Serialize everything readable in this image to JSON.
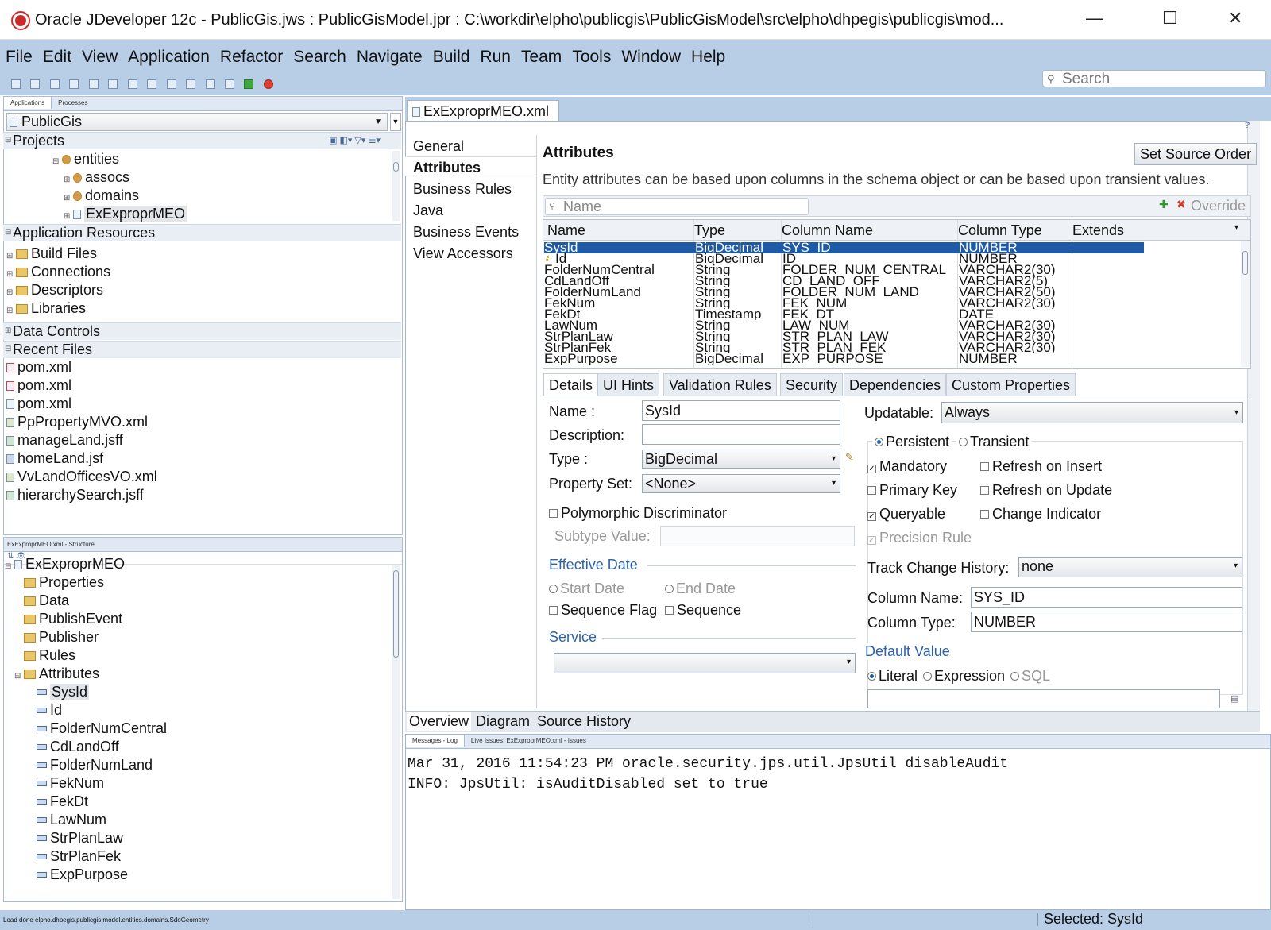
{
  "titlebar": {
    "title": "Oracle JDeveloper 12c - PublicGis.jws : PublicGisModel.jpr : C:\\workdir\\elpho\\publicgis\\PublicGisModel\\src\\elpho\\dhpegis\\publicgis\\mod...",
    "minimize": "—",
    "maximize": "☐",
    "close": "✕"
  },
  "menubar": [
    "File",
    "Edit",
    "View",
    "Application",
    "Refactor",
    "Search",
    "Navigate",
    "Build",
    "Run",
    "Team",
    "Tools",
    "Window",
    "Help"
  ],
  "search": {
    "placeholder": "Search"
  },
  "apps_panel": {
    "tabs": [
      "Applications",
      "Processes"
    ],
    "app_selector": "PublicGis",
    "projects_label": "Projects",
    "project_items": [
      "entities",
      "assocs",
      "domains",
      "ExExproprMEO"
    ],
    "app_resources_label": "Application Resources",
    "app_resource_items": [
      "Build Files",
      "Connections",
      "Descriptors",
      "Libraries"
    ],
    "data_controls_label": "Data Controls",
    "recent_files_label": "Recent Files",
    "recent_files": [
      "pom.xml",
      "pom.xml",
      "pom.xml",
      "PpPropertyMVO.xml",
      "manageLand.jsff",
      "homeLand.jsf",
      "VvLandOfficesVO.xml",
      "hierarchySearch.jsff"
    ]
  },
  "structure_panel": {
    "title": "ExExproprMEO.xml - Structure",
    "root": "ExExproprMEO",
    "folders": [
      "Properties",
      "Data",
      "PublishEvent",
      "Publisher",
      "Rules",
      "Attributes"
    ],
    "attributes": [
      "SysId",
      "Id",
      "FolderNumCentral",
      "CdLandOff",
      "FolderNumLand",
      "FekNum",
      "FekDt",
      "LawNum",
      "StrPlanLaw",
      "StrPlanFek",
      "ExpPurpose"
    ]
  },
  "editor": {
    "tab_label": "ExExproprMEO.xml",
    "nav": [
      "General",
      "Attributes",
      "Business Rules",
      "Java",
      "Business Events",
      "View Accessors"
    ],
    "heading": "Attributes",
    "set_source_order": "Set Source Order",
    "description": "Entity attributes can be based upon columns in the schema object or can be based upon transient values.",
    "filter_placeholder": "Name",
    "override_label": "Override",
    "grid_headers": [
      "Name",
      "Type",
      "Column Name",
      "Column Type",
      "Extends"
    ],
    "grid_rows": [
      [
        "SysId",
        "BigDecimal",
        "SYS_ID",
        "NUMBER"
      ],
      [
        "Id",
        "BigDecimal",
        "ID",
        "NUMBER"
      ],
      [
        "FolderNumCentral",
        "String",
        "FOLDER_NUM_CENTRAL",
        "VARCHAR2(30)"
      ],
      [
        "CdLandOff",
        "String",
        "CD_LAND_OFF",
        "VARCHAR2(5)"
      ],
      [
        "FolderNumLand",
        "String",
        "FOLDER_NUM_LAND",
        "VARCHAR2(50)"
      ],
      [
        "FekNum",
        "String",
        "FEK_NUM",
        "VARCHAR2(30)"
      ],
      [
        "FekDt",
        "Timestamp",
        "FEK_DT",
        "DATE"
      ],
      [
        "LawNum",
        "String",
        "LAW_NUM",
        "VARCHAR2(30)"
      ],
      [
        "StrPlanLaw",
        "String",
        "STR_PLAN_LAW",
        "VARCHAR2(30)"
      ],
      [
        "StrPlanFek",
        "String",
        "STR_PLAN_FEK",
        "VARCHAR2(30)"
      ],
      [
        "ExpPurpose_",
        "BigDecimal",
        "EXP_PURPOSE",
        "NUMBER"
      ]
    ],
    "subtabs": [
      "Details",
      "UI Hints",
      "Validation Rules",
      "Security",
      "Dependencies",
      "Custom Properties"
    ],
    "details": {
      "name_label": "Name :",
      "name_value": "SysId",
      "description_label": "Description:",
      "description_value": "",
      "type_label": "Type :",
      "type_value": "BigDecimal",
      "property_set_label": "Property Set:",
      "property_set_value": "<None>",
      "polymorphic": "Polymorphic Discriminator",
      "subtype_label": "Subtype Value:",
      "effective_date_label": "Effective Date",
      "start_date": "Start Date",
      "end_date": "End Date",
      "sequence_flag": "Sequence Flag",
      "sequence": "Sequence",
      "service_label": "Service",
      "service_value": "",
      "updatable_label": "Updatable:",
      "updatable_value": "Always",
      "persistent": "Persistent",
      "transient": "Transient",
      "mandatory": "Mandatory",
      "refresh_insert": "Refresh on Insert",
      "primary_key": "Primary Key",
      "refresh_update": "Refresh on Update",
      "queryable": "Queryable",
      "change_indicator": "Change Indicator",
      "precision_rule": "Precision Rule",
      "track_label": "Track Change History:",
      "track_value": "none",
      "column_name_label": "Column Name:",
      "column_name_value": "SYS_ID",
      "column_type_label": "Column Type:",
      "column_type_value": "NUMBER",
      "default_value_label": "Default Value",
      "literal": "Literal",
      "expression": "Expression",
      "sql": "SQL"
    },
    "bottom_tabs": [
      "Overview",
      "Diagram",
      "Source",
      "History"
    ]
  },
  "log": {
    "tabs": [
      "Messages - Log",
      "Live Issues: ExExproprMEO.xml - Issues"
    ],
    "lines": [
      "Mar 31, 2016 11:54:23 PM oracle.security.jps.util.JpsUtil disableAudit",
      "INFO: JpsUtil: isAuditDisabled set to true"
    ]
  },
  "statusbar": {
    "left": "Load done   elpho.dhpegis.publicgis.model.entities.domains.SdoGeometry",
    "right": "Selected: SysId"
  }
}
